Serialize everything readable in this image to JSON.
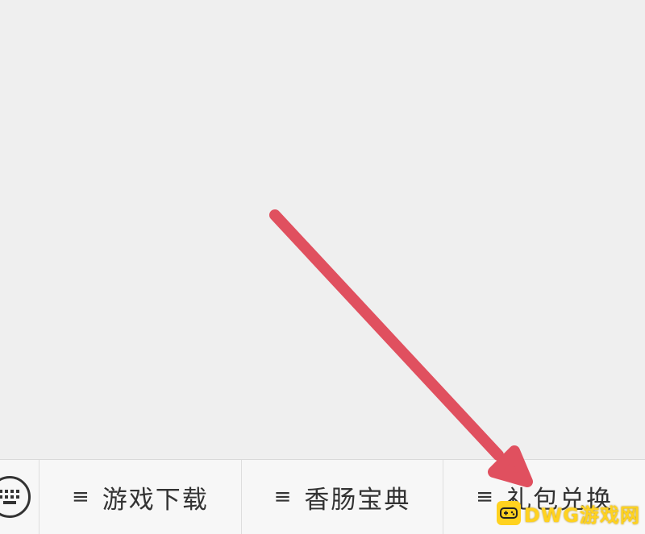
{
  "menu_bar": {
    "keyboard_icon": "keyboard-icon",
    "items": [
      {
        "icon": "menu-lines-icon",
        "icon_glyph": "≡",
        "label": "游戏下载"
      },
      {
        "icon": "menu-lines-icon",
        "icon_glyph": "≡",
        "label": "香肠宝典"
      },
      {
        "icon": "menu-lines-icon",
        "icon_glyph": "≡",
        "label": "礼包兑换"
      }
    ]
  },
  "annotation": {
    "icon": "red-arrow-icon",
    "color": "#e0505f"
  },
  "watermark": {
    "icon": "game-controller-icon",
    "text": "DWG游戏网",
    "color": "#ffd21f"
  }
}
